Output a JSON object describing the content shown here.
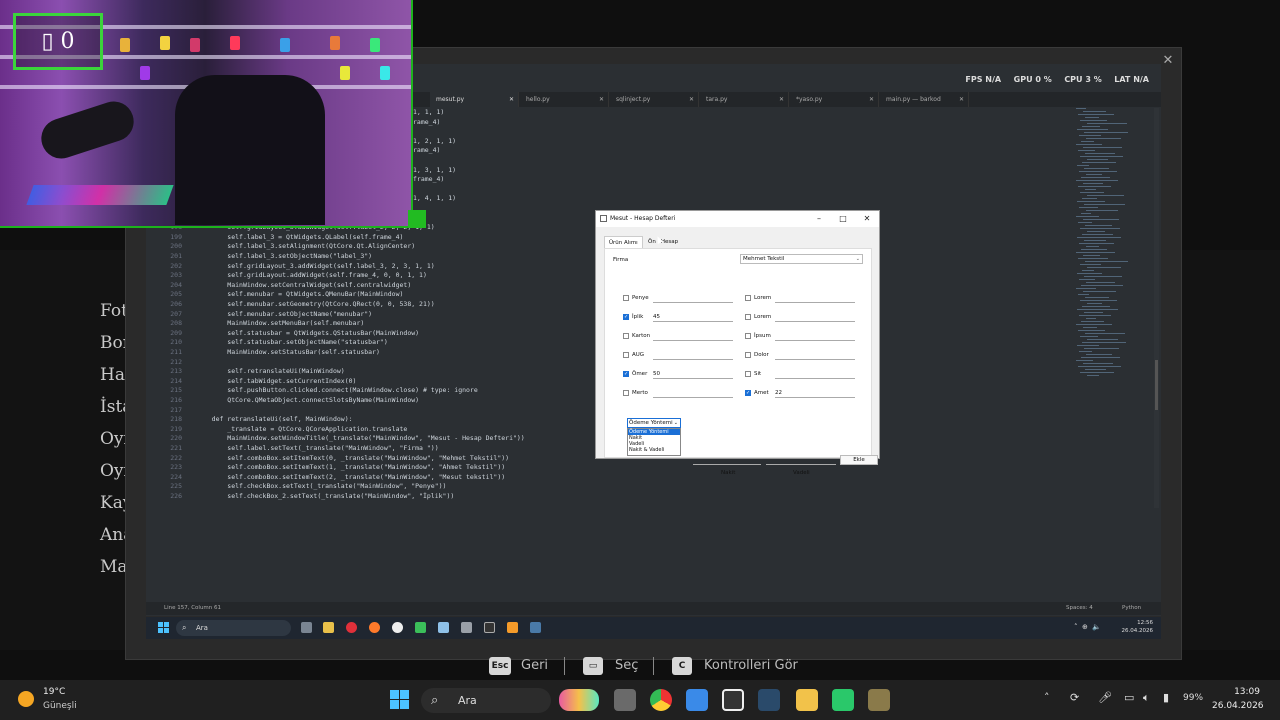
{
  "overlay": {
    "counter": "▯ 0",
    "left_menu": [
      "Fot",
      "Bor",
      "Haz",
      "İsta",
      "Oyı",
      "Oyı",
      "Kay",
      "Ana",
      "Mal"
    ]
  },
  "remote": {
    "close_icon": "✕"
  },
  "editor": {
    "perf": {
      "fps_label": "FPS",
      "fps": "N/A",
      "gpu_label": "GPU",
      "gpu": "0 %",
      "cpu_label": "CPU",
      "cpu": "3 %",
      "lat_label": "LAT",
      "lat": "N/A"
    },
    "tabs": [
      {
        "label": "mesut.py",
        "close": "✕",
        "active": true
      },
      {
        "label": "hello.py",
        "close": "✕"
      },
      {
        "label": "sqlinject.py",
        "close": "✕"
      },
      {
        "label": "tara.py",
        "close": "✕"
      },
      {
        "label": "*yaso.py",
        "close": "✕"
      },
      {
        "label": "main.py — barkod",
        "close": "✕"
      }
    ],
    "code_lines": [
      {
        "n": "",
        "t": "1, 1, 1)"
      },
      {
        "n": "",
        "t": "rame_4)"
      },
      {
        "n": "",
        "t": ""
      },
      {
        "n": "",
        "t": "1, 2, 1, 1)"
      },
      {
        "n": "",
        "t": "rame_4)"
      },
      {
        "n": "",
        "t": ""
      },
      {
        "n": "",
        "t": "1, 3, 1, 1)"
      },
      {
        "n": "",
        "t": "frame_4)"
      },
      {
        "n": "",
        "t": ""
      },
      {
        "n": "",
        "t": "1, 4, 1, 1)"
      },
      {
        "n": "",
        "t": ""
      },
      {
        "n": "",
        "t": ""
      },
      {
        "n": "198",
        "t": "        self.gridLayout_3.addWidget(self.label_2, 2, 2, 1, 1)"
      },
      {
        "n": "199",
        "t": "        self.label_3 = QtWidgets.QLabel(self.frame_4)"
      },
      {
        "n": "200",
        "t": "        self.label_3.setAlignment(QtCore.Qt.AlignCenter)"
      },
      {
        "n": "201",
        "t": "        self.label_3.setObjectName(\"label_3\")"
      },
      {
        "n": "202",
        "t": "        self.gridLayout_3.addWidget(self.label_3, 2, 3, 1, 1)"
      },
      {
        "n": "203",
        "t": "        self.gridLayout.addWidget(self.frame_4, 0, 0, 1, 1)"
      },
      {
        "n": "204",
        "t": "        MainWindow.setCentralWidget(self.centralwidget)"
      },
      {
        "n": "205",
        "t": "        self.menubar = QtWidgets.QMenuBar(MainWindow)"
      },
      {
        "n": "206",
        "t": "        self.menubar.setGeometry(QtCore.QRect(0, 0, 538, 21))"
      },
      {
        "n": "207",
        "t": "        self.menubar.setObjectName(\"menubar\")"
      },
      {
        "n": "208",
        "t": "        MainWindow.setMenuBar(self.menubar)"
      },
      {
        "n": "209",
        "t": "        self.statusbar = QtWidgets.QStatusBar(MainWindow)"
      },
      {
        "n": "210",
        "t": "        self.statusbar.setObjectName(\"statusbar\")"
      },
      {
        "n": "211",
        "t": "        MainWindow.setStatusBar(self.statusbar)"
      },
      {
        "n": "212",
        "t": ""
      },
      {
        "n": "213",
        "t": "        self.retranslateUi(MainWindow)"
      },
      {
        "n": "214",
        "t": "        self.tabWidget.setCurrentIndex(0)"
      },
      {
        "n": "215",
        "t": "        self.pushButton.clicked.connect(MainWindow.close) # type: ignore"
      },
      {
        "n": "216",
        "t": "        QtCore.QMetaObject.connectSlotsByName(MainWindow)"
      },
      {
        "n": "217",
        "t": ""
      },
      {
        "n": "218",
        "t": "    def retranslateUi(self, MainWindow):"
      },
      {
        "n": "219",
        "t": "        _translate = QtCore.QCoreApplication.translate"
      },
      {
        "n": "220",
        "t": "        MainWindow.setWindowTitle(_translate(\"MainWindow\", \"Mesut - Hesap Defteri\"))"
      },
      {
        "n": "221",
        "t": "        self.label.setText(_translate(\"MainWindow\", \"Firma \"))"
      },
      {
        "n": "222",
        "t": "        self.comboBox.setItemText(0, _translate(\"MainWindow\", \"Mehmet Tekstil\"))"
      },
      {
        "n": "223",
        "t": "        self.comboBox.setItemText(1, _translate(\"MainWindow\", \"Ahmet Tekstil\"))"
      },
      {
        "n": "224",
        "t": "        self.comboBox.setItemText(2, _translate(\"MainWindow\", \"Mesut tekstil\"))"
      },
      {
        "n": "225",
        "t": "        self.checkBox.setText(_translate(\"MainWindow\", \"Penye\"))"
      },
      {
        "n": "226",
        "t": "        self.checkBox_2.setText(_translate(\"MainWindow\", \"İplik\"))"
      }
    ],
    "status": {
      "position": "Line 157, Column 61",
      "spaces": "Spaces: 4",
      "language": "Python"
    },
    "inner_taskbar": {
      "search": "Ara",
      "time": "12:56",
      "date": "26.04.2026"
    }
  },
  "dialog": {
    "title": "Mesut - Hesap Defteri",
    "controls": {
      "min": "–",
      "max": "□",
      "close": "✕"
    },
    "tabs": [
      "Ürün Alımı",
      "Ön  i Hesap"
    ],
    "firma_label": "Firma",
    "firma_value": "Mehmet Tekstil",
    "checks_left": [
      {
        "label": "Penye",
        "checked": false,
        "value": ""
      },
      {
        "label": "İplik",
        "checked": true,
        "value": "45"
      },
      {
        "label": "Karton",
        "checked": false,
        "value": ""
      },
      {
        "label": "AUG",
        "checked": false,
        "value": ""
      },
      {
        "label": "Ömer",
        "checked": true,
        "value": "50"
      },
      {
        "label": "Merto",
        "checked": false,
        "value": ""
      }
    ],
    "checks_right": [
      {
        "label": "Lorem",
        "checked": false,
        "value": ""
      },
      {
        "label": "Lorem",
        "checked": false,
        "value": ""
      },
      {
        "label": "İpsum",
        "checked": false,
        "value": ""
      },
      {
        "label": "Dolor",
        "checked": false,
        "value": ""
      },
      {
        "label": "Sit",
        "checked": false,
        "value": ""
      },
      {
        "label": "Amet",
        "checked": true,
        "value": "22"
      }
    ],
    "odeme_combo": "Ödeme Yöntemi",
    "odeme_options": [
      "Ödeme Yöntemi",
      "Nakit",
      "Vadeli",
      "Nakit & Vadeli"
    ],
    "nakit_label": "Nakit",
    "vadeli_label": "Vadeli",
    "ekle_label": "Ekle"
  },
  "hints": [
    {
      "key": "Esc",
      "label": "Geri"
    },
    {
      "key": "▭",
      "label": "Seç"
    },
    {
      "key": "C",
      "label": "Kontrolleri Gör"
    }
  ],
  "taskbar": {
    "weather_temp": "19°C",
    "weather_desc": "Güneşli",
    "search": "Ara",
    "battery": "99%",
    "time": "13:09",
    "date": "26.04.2026"
  },
  "colors": {
    "accent": "#4cc2ff",
    "checked": "#1a6fd6",
    "cam_border": "#1db31d"
  }
}
